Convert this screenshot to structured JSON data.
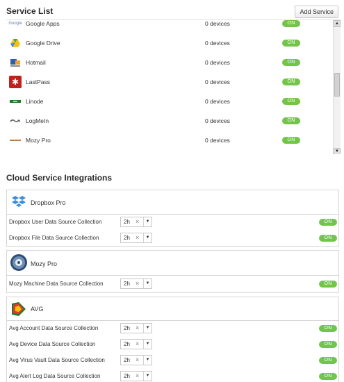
{
  "service_list": {
    "title": "Service List",
    "add_button": "Add Service",
    "items": [
      {
        "name": "Google Apps",
        "devices": "0 devices",
        "status": "ON",
        "icon": "google-apps-icon",
        "icon_text": "Google",
        "icon_color": "#5f7fbf"
      },
      {
        "name": "Google Drive",
        "devices": "0 devices",
        "status": "ON",
        "icon": "google-drive-icon",
        "icon_color": "#2f9e44"
      },
      {
        "name": "Hotmail",
        "devices": "0 devices",
        "status": "ON",
        "icon": "hotmail-icon",
        "icon_color": "#2a5fb0"
      },
      {
        "name": "LastPass",
        "devices": "0 devices",
        "status": "ON",
        "icon": "lastpass-icon",
        "icon_color": "#c21f1f"
      },
      {
        "name": "Linode",
        "devices": "0 devices",
        "status": "ON",
        "icon": "linode-icon",
        "icon_color": "#1a7a2a"
      },
      {
        "name": "LogMeIn",
        "devices": "0 devices",
        "status": "ON",
        "icon": "logmein-icon",
        "icon_color": "#555555"
      },
      {
        "name": "Mozy Pro",
        "devices": "0 devices",
        "status": "ON",
        "icon": "mozy-pro-icon",
        "icon_color": "#c07a3a"
      }
    ]
  },
  "integrations": {
    "title": "Cloud Service Integrations",
    "panels": [
      {
        "name": "Dropbox Pro",
        "icon": "dropbox-icon",
        "rows": [
          {
            "label": "Dropbox User Data Source Collection",
            "interval": "2h",
            "status": "ON"
          },
          {
            "label": "Dropbox File Data Source Collection",
            "interval": "2h",
            "status": "ON"
          }
        ]
      },
      {
        "name": "Mozy Pro",
        "icon": "mozy-gear-icon",
        "rows": [
          {
            "label": "Mozy Machine Data Source Collection",
            "interval": "2h",
            "status": "ON"
          }
        ]
      },
      {
        "name": "AVG",
        "icon": "avg-icon",
        "rows": [
          {
            "label": "Avg Account Data Source Collection",
            "interval": "2h",
            "status": "ON"
          },
          {
            "label": "Avg Device Data Source Collection",
            "interval": "2h",
            "status": "ON"
          },
          {
            "label": "Avg Virus Vault Data Source Collection",
            "interval": "2h",
            "status": "ON"
          },
          {
            "label": "Avg Alert Log Data Source Collection",
            "interval": "2h",
            "status": "ON"
          }
        ]
      }
    ]
  },
  "colors": {
    "on_pill": "#73c54a",
    "border": "#d6d6d6"
  }
}
